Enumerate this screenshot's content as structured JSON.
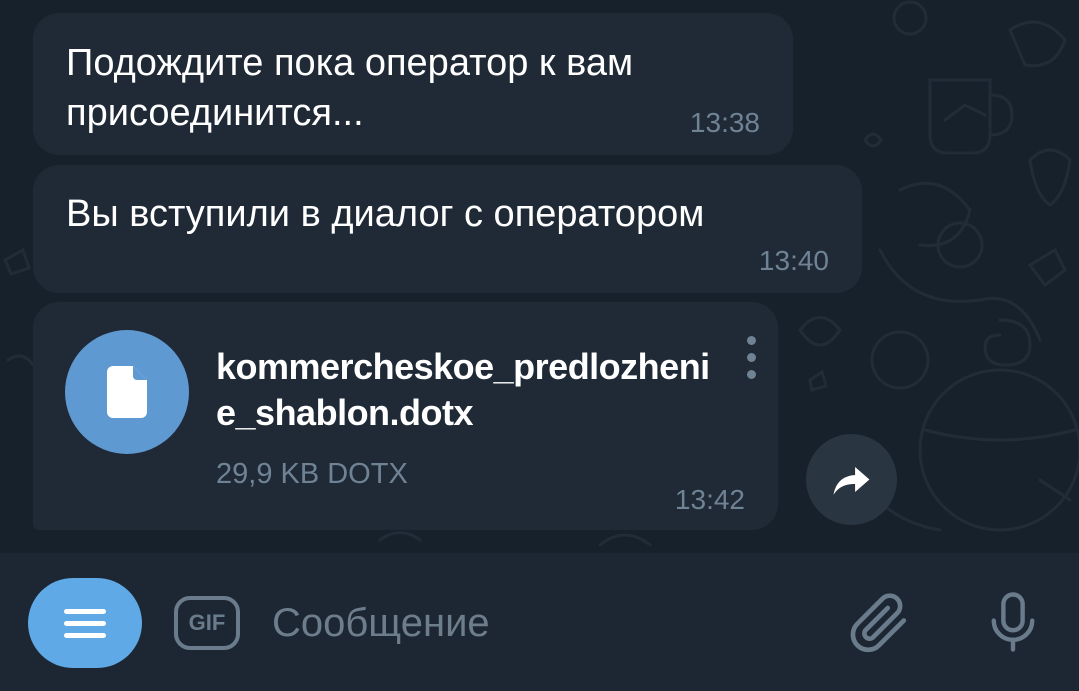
{
  "messages": [
    {
      "text": "Подождите пока оператор к вам\nприсоединится...",
      "time": "13:38"
    },
    {
      "text": "Вы вступили в диалог с оператором",
      "time": "13:40"
    }
  ],
  "file_message": {
    "file_name": "kommercheskoe_predlozhenie_shablon.dotx",
    "file_info": "29,9 KB DOTX",
    "time": "13:42",
    "icon": "document-icon"
  },
  "input_bar": {
    "gif_label": "GIF",
    "placeholder": "Сообщение",
    "value": ""
  },
  "colors": {
    "chat_background": "#17212b",
    "bubble": "#1f2a36",
    "accent": "#5ea9e6",
    "file_circle": "#5e99d2",
    "secondary_text": "#6f8394"
  }
}
